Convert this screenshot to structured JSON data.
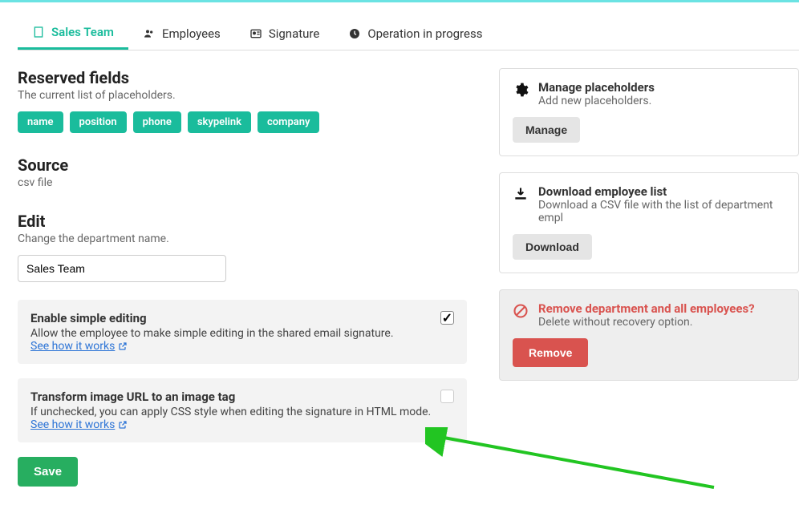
{
  "tabs": {
    "salesTeam": "Sales Team",
    "employees": "Employees",
    "signature": "Signature",
    "operation": "Operation in progress"
  },
  "reserved": {
    "title": "Reserved fields",
    "sub": "The current list of placeholders.",
    "pills": [
      "name",
      "position",
      "phone",
      "skypelink",
      "company"
    ]
  },
  "source": {
    "title": "Source",
    "value": "csv file"
  },
  "edit": {
    "title": "Edit",
    "sub": "Change the department name.",
    "value": "Sales Team"
  },
  "opt1": {
    "title": "Enable simple editing",
    "desc": "Allow the employee to make simple editing in the shared email signature.",
    "link": "See how it works"
  },
  "opt2": {
    "title": "Transform image URL to an image tag",
    "descPre": "If unchecked, you can apply CSS style when editing the signature in HTML mode. ",
    "link": "See how it works"
  },
  "saveLabel": "Save",
  "placeholders": {
    "title": "Manage placeholders",
    "sub": "Add new placeholders.",
    "btn": "Manage"
  },
  "download": {
    "title": "Download employee list",
    "sub": "Download a CSV file with the list of department empl",
    "btn": "Download"
  },
  "remove": {
    "title": "Remove department and all employees?",
    "sub": "Delete without recovery option.",
    "btn": "Remove"
  }
}
